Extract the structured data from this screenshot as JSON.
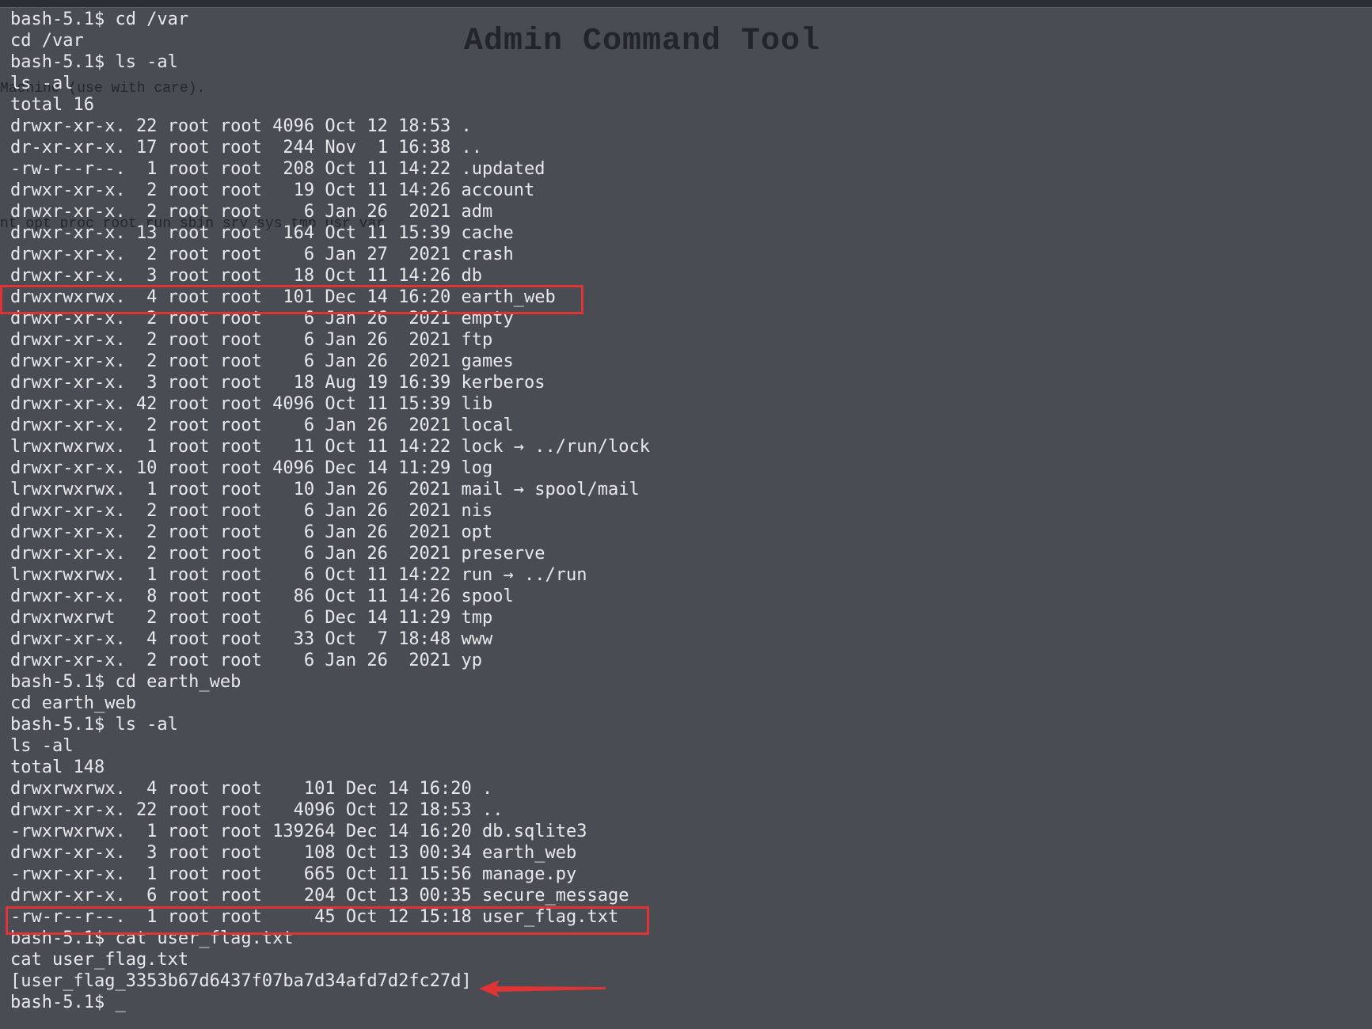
{
  "window": {
    "background_title": "Admin Command Tool",
    "background_line_1": "Machine (use with care).",
    "background_line_2": "nt opt proc root run sbin srv sys tmp usr var"
  },
  "terminal": {
    "lines": [
      "bash-5.1$ cd /var",
      "cd /var",
      "bash-5.1$ ls -al",
      "ls -al",
      "total 16",
      "drwxr-xr-x. 22 root root 4096 Oct 12 18:53 .",
      "dr-xr-xr-x. 17 root root  244 Nov  1 16:38 ..",
      "-rw-r--r--.  1 root root  208 Oct 11 14:22 .updated",
      "drwxr-xr-x.  2 root root   19 Oct 11 14:26 account",
      "drwxr-xr-x.  2 root root    6 Jan 26  2021 adm",
      "drwxr-xr-x. 13 root root  164 Oct 11 15:39 cache",
      "drwxr-xr-x.  2 root root    6 Jan 27  2021 crash",
      "drwxr-xr-x.  3 root root   18 Oct 11 14:26 db",
      "drwxrwxrwx.  4 root root  101 Dec 14 16:20 earth_web",
      "drwxr-xr-x.  2 root root    6 Jan 26  2021 empty",
      "drwxr-xr-x.  2 root root    6 Jan 26  2021 ftp",
      "drwxr-xr-x.  2 root root    6 Jan 26  2021 games",
      "drwxr-xr-x.  3 root root   18 Aug 19 16:39 kerberos",
      "drwxr-xr-x. 42 root root 4096 Oct 11 15:39 lib",
      "drwxr-xr-x.  2 root root    6 Jan 26  2021 local",
      "lrwxrwxrwx.  1 root root   11 Oct 11 14:22 lock → ../run/lock",
      "drwxr-xr-x. 10 root root 4096 Dec 14 11:29 log",
      "lrwxrwxrwx.  1 root root   10 Jan 26  2021 mail → spool/mail",
      "drwxr-xr-x.  2 root root    6 Jan 26  2021 nis",
      "drwxr-xr-x.  2 root root    6 Jan 26  2021 opt",
      "drwxr-xr-x.  2 root root    6 Jan 26  2021 preserve",
      "lrwxrwxrwx.  1 root root    6 Oct 11 14:22 run → ../run",
      "drwxr-xr-x.  8 root root   86 Oct 11 14:26 spool",
      "drwxrwxrwt   2 root root    6 Dec 14 11:29 tmp",
      "drwxr-xr-x.  4 root root   33 Oct  7 18:48 www",
      "drwxr-xr-x.  2 root root    6 Jan 26  2021 yp",
      "bash-5.1$ cd earth_web",
      "cd earth_web",
      "bash-5.1$ ls -al",
      "ls -al",
      "total 148",
      "drwxrwxrwx.  4 root root    101 Dec 14 16:20 .",
      "drwxr-xr-x. 22 root root   4096 Oct 12 18:53 ..",
      "-rwxrwxrwx.  1 root root 139264 Dec 14 16:20 db.sqlite3",
      "drwxr-xr-x.  3 root root    108 Oct 13 00:34 earth_web",
      "-rwxr-xr-x.  1 root root    665 Oct 11 15:56 manage.py",
      "drwxr-xr-x.  6 root root    204 Oct 13 00:35 secure_message",
      "-rw-r--r--.  1 root root     45 Oct 12 15:18 user_flag.txt",
      "bash-5.1$ cat user_flag.txt",
      "cat user_flag.txt",
      "[user_flag_3353b67d6437f07ba7d34afd7d2fc27d]"
    ],
    "prompt": "bash-5.1$ ",
    "cursor": "_"
  },
  "annotations": {
    "color": "#e03434"
  }
}
